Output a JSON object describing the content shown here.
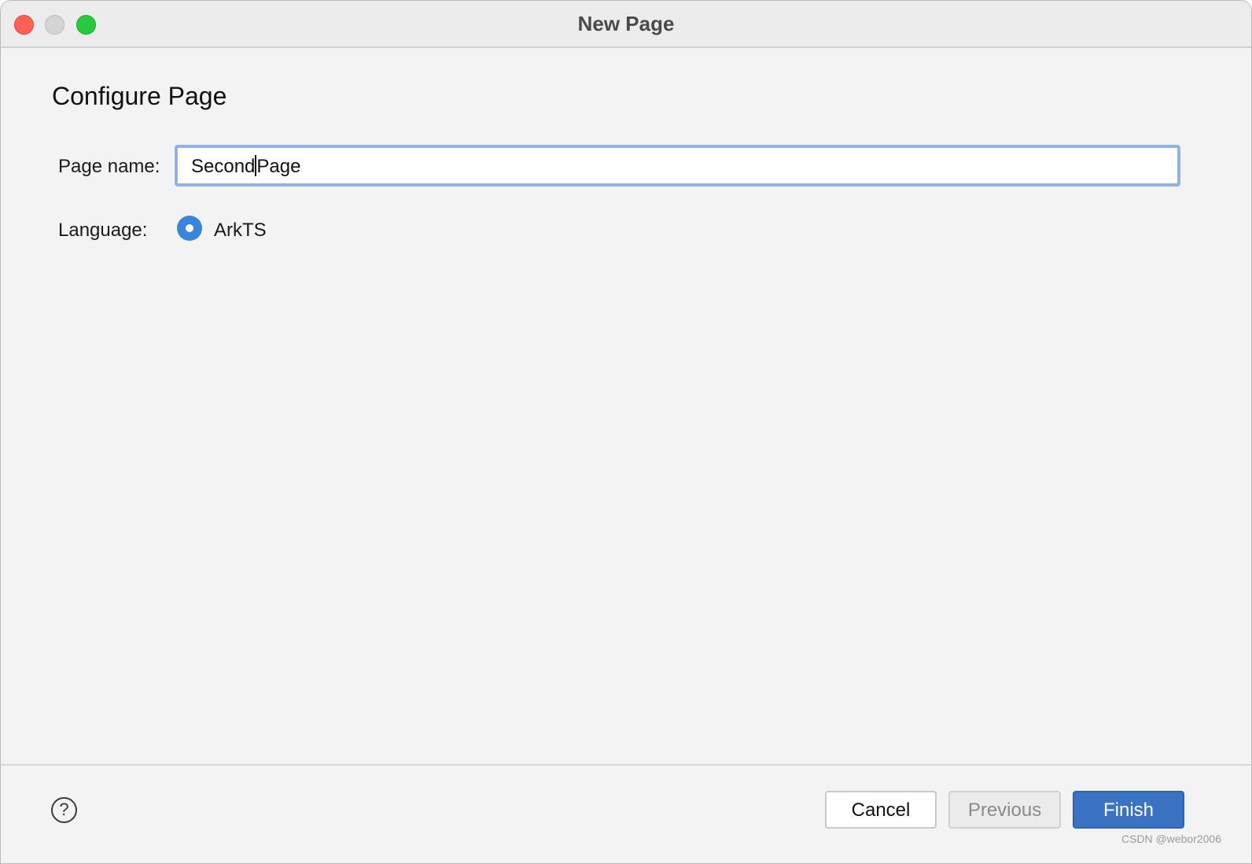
{
  "window": {
    "title": "New Page"
  },
  "content": {
    "section_title": "Configure Page",
    "page_name": {
      "label": "Page name:",
      "value_before_caret": "Second",
      "value_after_caret": "Page"
    },
    "language": {
      "label": "Language:",
      "option": "ArkTS",
      "selected": true
    }
  },
  "footer": {
    "help_icon": "?",
    "cancel_label": "Cancel",
    "previous_label": "Previous",
    "finish_label": "Finish"
  },
  "watermark": "CSDN @webor2006",
  "colors": {
    "accent": "#3a73c3",
    "radio": "#3b84dd",
    "focus_ring": "#8fb3e4",
    "close": "#fe5f57",
    "zoom": "#28c840"
  }
}
